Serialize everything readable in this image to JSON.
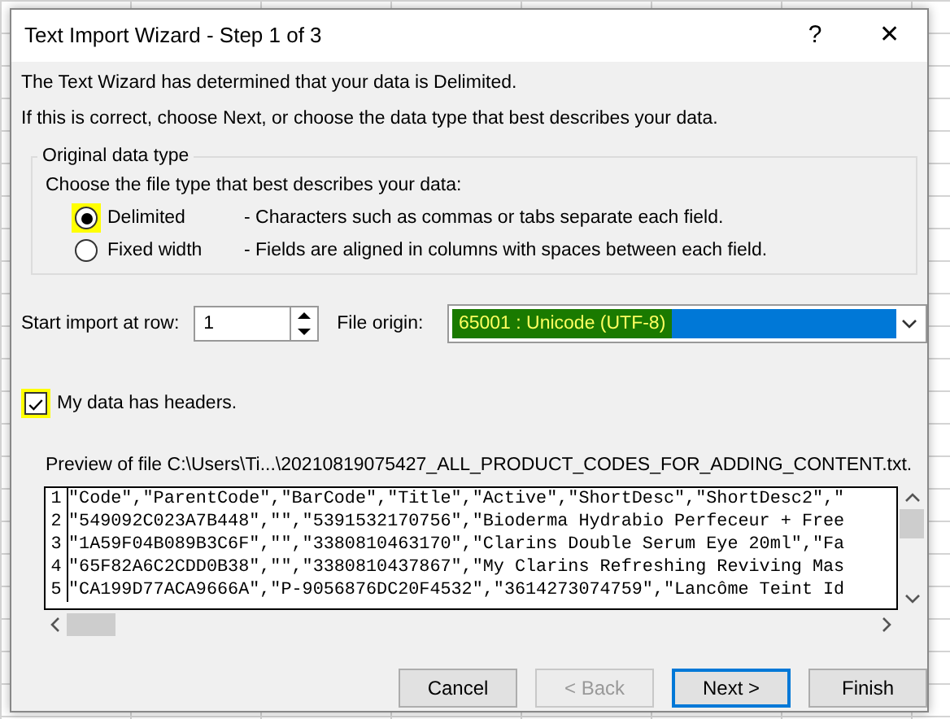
{
  "window": {
    "title": "Text Import Wizard - Step 1 of 3",
    "help": "?",
    "close": "✕"
  },
  "intro": [
    "The Text Wizard has determined that your data is Delimited.",
    "If this is correct, choose Next, or choose the data type that best describes your data."
  ],
  "data_type": {
    "legend": "Original data type",
    "prompt": "Choose the file type that best describes your data:",
    "options": [
      {
        "label": "Delimited",
        "description": "- Characters such as commas or tabs separate each field.",
        "selected": true,
        "highlighted": true
      },
      {
        "label": "Fixed width",
        "description": "- Fields are aligned in columns with spaces between each field.",
        "selected": false,
        "highlighted": false
      }
    ]
  },
  "start_row": {
    "label": "Start import at row:",
    "value": "1"
  },
  "file_origin": {
    "label": "File origin:",
    "value": "65001 : Unicode (UTF-8)",
    "highlighted": true
  },
  "headers": {
    "label": "My data has headers.",
    "checked": true,
    "highlighted": true
  },
  "preview": {
    "label": "Preview of file C:\\Users\\Ti...\\20210819075427_ALL_PRODUCT_CODES_FOR_ADDING_CONTENT.txt.",
    "rows": [
      {
        "number": "1",
        "text": "\"Code\",\"ParentCode\",\"BarCode\",\"Title\",\"Active\",\"ShortDesc\",\"ShortDesc2\",\""
      },
      {
        "number": "2",
        "text": "\"549092C023A7B448\",\"\",\"5391532170756\",\"Bioderma Hydrabio Perfeceur + Free"
      },
      {
        "number": "3",
        "text": "\"1A59F04B089B3C6F\",\"\",\"3380810463170\",\"Clarins Double Serum Eye 20ml\",\"Fa"
      },
      {
        "number": "4",
        "text": "\"65F82A6C2CDD0B38\",\"\",\"3380810437867\",\"My Clarins Refreshing Reviving Mas"
      },
      {
        "number": "5",
        "text": "\"CA199D77ACA9666A\",\"P-9056876DC20F4532\",\"3614273074759\",\"Lancôme Teint Id"
      }
    ]
  },
  "buttons": [
    {
      "label": "Cancel",
      "disabled": false,
      "default": false
    },
    {
      "label": "< Back",
      "disabled": true,
      "default": false
    },
    {
      "label": "Next >",
      "disabled": false,
      "default": true
    },
    {
      "label": "Finish",
      "disabled": false,
      "default": false
    }
  ]
}
